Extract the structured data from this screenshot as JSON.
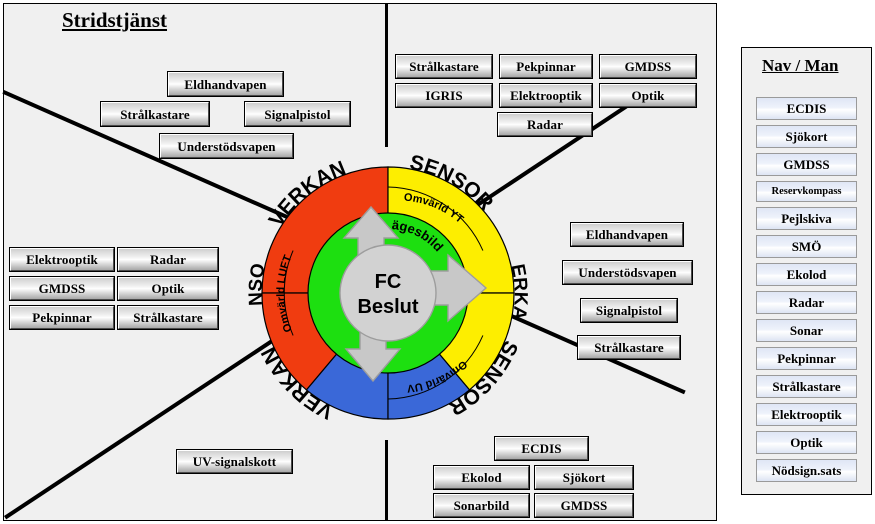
{
  "main": {
    "title": "Stridstjänst",
    "background": "#f0f0f0"
  },
  "sidebar": {
    "title": "Nav / Man",
    "items": [
      {
        "label": "ECDIS"
      },
      {
        "label": "Sjökort"
      },
      {
        "label": "GMDSS"
      },
      {
        "label": "Reservkompass"
      },
      {
        "label": "Pejlskiva"
      },
      {
        "label": "SMÖ"
      },
      {
        "label": "Ekolod"
      },
      {
        "label": "Radar"
      },
      {
        "label": "Sonar"
      },
      {
        "label": "Pekpinnar"
      },
      {
        "label": "Strålkastare"
      },
      {
        "label": "Elektrooptik"
      },
      {
        "label": "Optik"
      },
      {
        "label": "Nödsign.sats"
      }
    ]
  },
  "quadrant_upper_left": {
    "name": "verkan-luft",
    "items": [
      {
        "label": "Eldhandvapen"
      },
      {
        "label": "Strålkastare"
      },
      {
        "label": "Signalpistol"
      },
      {
        "label": "Understödsvapen"
      }
    ]
  },
  "quadrant_upper_right": {
    "name": "sensor-yta",
    "items": [
      {
        "label": "Strålkastare"
      },
      {
        "label": "Pekpinnar"
      },
      {
        "label": "GMDSS"
      },
      {
        "label": "IGRIS"
      },
      {
        "label": "Elektrooptik"
      },
      {
        "label": "Optik"
      },
      {
        "label": "Radar"
      }
    ]
  },
  "quadrant_left": {
    "name": "sensor-luft",
    "items": [
      {
        "label": "Elektrooptik"
      },
      {
        "label": "Radar"
      },
      {
        "label": "GMDSS"
      },
      {
        "label": "Optik"
      },
      {
        "label": "Pekpinnar"
      },
      {
        "label": "Strålkastare"
      }
    ]
  },
  "quadrant_right": {
    "name": "verkan-yta",
    "items": [
      {
        "label": "Eldhandvapen"
      },
      {
        "label": "Understödsvapen"
      },
      {
        "label": "Signalpistol"
      },
      {
        "label": "Strålkastare"
      }
    ]
  },
  "quadrant_lower_left": {
    "name": "verkan-undervatten",
    "items": [
      {
        "label": "UV-signalskott"
      }
    ]
  },
  "quadrant_lower_right": {
    "name": "sensor-undervatten",
    "items": [
      {
        "label": "ECDIS"
      },
      {
        "label": "Ekolod"
      },
      {
        "label": "Sjökort"
      },
      {
        "label": "Sonarbild"
      },
      {
        "label": "GMDSS"
      }
    ]
  },
  "wheel": {
    "center_line1": "FC",
    "center_line2": "Beslut",
    "inner_ring_label": "Lägesbild",
    "segments": [
      {
        "id": "verkan-upper-left",
        "outer_label": "VERKAN",
        "color": "#f03c10"
      },
      {
        "id": "sensor-luft",
        "outer_label": "SENSOR",
        "mid_label": "Omvärld LUFT",
        "color": "#f03c10"
      },
      {
        "id": "sensor-yta",
        "outer_label": "SENSOR",
        "mid_label": "Omvärld YT",
        "color": "#fdee00"
      },
      {
        "id": "verkan-yta",
        "outer_label": "VERKAN",
        "color": "#fdee00"
      },
      {
        "id": "verkan-uv",
        "outer_label": "VERKAN",
        "color": "#3a68d8"
      },
      {
        "id": "sensor-uv",
        "outer_label": "SENSOR",
        "mid_label": "Omvärld UV",
        "color": "#3a68d8"
      }
    ],
    "colors": {
      "red": "#f03c10",
      "yellow": "#fdee00",
      "blue": "#3a68d8",
      "green": "#1ddf10",
      "hub": "#d2d2d2",
      "arrow": "#c8c8c8"
    }
  }
}
